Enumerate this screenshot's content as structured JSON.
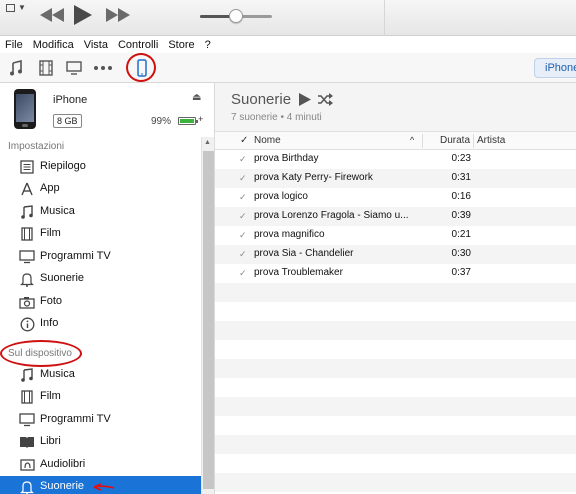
{
  "menubar": [
    "File",
    "Modifica",
    "Vista",
    "Controlli",
    "Store",
    "?"
  ],
  "toolbar": {
    "icons": [
      "music-note-icon",
      "film-icon",
      "tv-icon",
      "more-icon",
      "iphone-icon"
    ],
    "device_button": "iPhone"
  },
  "playback": {
    "volume": 0.5
  },
  "device": {
    "name": "iPhone",
    "capacity": "8 GB",
    "battery_pct": "99%",
    "battery_level": 0.99
  },
  "sidebar": {
    "settings_label": "Impostazioni",
    "settings_items": [
      {
        "label": "Riepilogo",
        "icon": "summary-icon"
      },
      {
        "label": "App",
        "icon": "app-icon"
      },
      {
        "label": "Musica",
        "icon": "music-note-icon"
      },
      {
        "label": "Film",
        "icon": "film-icon"
      },
      {
        "label": "Programmi TV",
        "icon": "tv-icon"
      },
      {
        "label": "Suonerie",
        "icon": "bell-icon"
      },
      {
        "label": "Foto",
        "icon": "camera-icon"
      },
      {
        "label": "Info",
        "icon": "info-icon"
      }
    ],
    "device_label": "Sul dispositivo",
    "device_items": [
      {
        "label": "Musica",
        "icon": "music-note-icon"
      },
      {
        "label": "Film",
        "icon": "film-icon"
      },
      {
        "label": "Programmi TV",
        "icon": "tv-icon"
      },
      {
        "label": "Libri",
        "icon": "book-icon"
      },
      {
        "label": "Audiolibri",
        "icon": "audiobook-icon"
      },
      {
        "label": "Suonerie",
        "icon": "bell-icon",
        "selected": true
      }
    ]
  },
  "main": {
    "title": "Suonerie",
    "subtitle": "7 suonerie • 4 minuti",
    "columns": {
      "check": "✓",
      "name": "Nome",
      "duration": "Durata",
      "artist": "Artista"
    },
    "rows": [
      {
        "name": "prova Birthday",
        "duration": "0:23",
        "artist": ""
      },
      {
        "name": "prova Katy Perry- Firework",
        "duration": "0:31",
        "artist": ""
      },
      {
        "name": "prova logico",
        "duration": "0:16",
        "artist": ""
      },
      {
        "name": "prova Lorenzo Fragola - Siamo u...",
        "duration": "0:39",
        "artist": ""
      },
      {
        "name": "prova magnifico",
        "duration": "0:21",
        "artist": ""
      },
      {
        "name": "prova Sia - Chandelier",
        "duration": "0:30",
        "artist": ""
      },
      {
        "name": "prova Troublemaker",
        "duration": "0:37",
        "artist": ""
      }
    ]
  },
  "colors": {
    "accent": "#1a73d6",
    "annotation": "#d01010"
  }
}
